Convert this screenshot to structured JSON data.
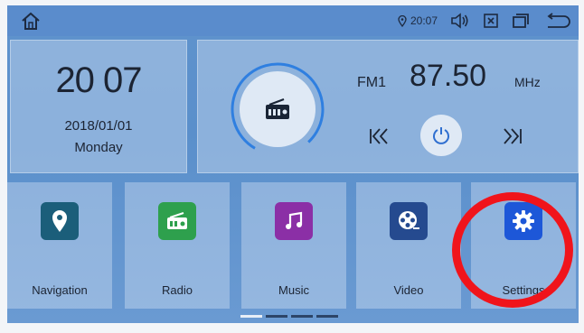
{
  "status_bar": {
    "time": "20:07",
    "icons": [
      "home-icon",
      "location-pin-icon",
      "volume-icon",
      "close-box-icon",
      "window-icon",
      "back-icon"
    ]
  },
  "clock": {
    "time": "20 07",
    "date": "2018/01/01",
    "day": "Monday"
  },
  "radio": {
    "band": "FM1",
    "frequency": "87.50",
    "unit": "MHz",
    "prev_symbol": "|<<",
    "next_symbol": ">>|"
  },
  "apps": [
    {
      "label": "Navigation",
      "icon": "map-pin-icon",
      "color": "#1b5e7a"
    },
    {
      "label": "Radio",
      "icon": "radio-icon",
      "color": "#2ea04d"
    },
    {
      "label": "Music",
      "icon": "music-note-icon",
      "color": "#8b2fa6"
    },
    {
      "label": "Video",
      "icon": "film-reel-icon",
      "color": "#254a8f"
    },
    {
      "label": "Settings",
      "icon": "gear-icon",
      "color": "#1d57d8"
    }
  ],
  "colors": {
    "screen_bg": "#5f93cd",
    "highlight": "#f0141b",
    "accent_ring": "#2f7fe0"
  },
  "pager": {
    "pages": 4,
    "active": 1
  }
}
